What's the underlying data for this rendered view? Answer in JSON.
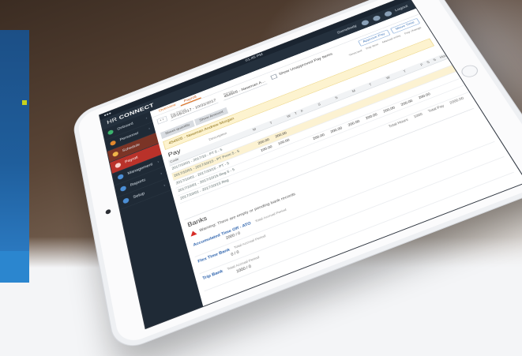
{
  "device": {
    "time": "01:45 PM"
  },
  "app": {
    "brand_light": "HR",
    "brand_bold": "CONNECT",
    "top_right": [
      "Somebody",
      "Logout"
    ]
  },
  "sidebar": {
    "items": [
      {
        "label": "Onboard"
      },
      {
        "label": "Personnel"
      },
      {
        "label": "Schedule"
      },
      {
        "label": "Payroll"
      },
      {
        "label": "Management"
      },
      {
        "label": "Reports"
      },
      {
        "label": "Setup"
      }
    ]
  },
  "tabs": [
    "Overview",
    "Payroll"
  ],
  "filters": {
    "pay_period_label": "Pay Period",
    "pay_period": "10/16/2017 - 10/31/2017",
    "person_label": "Person",
    "person_value": "454505 - Newman A...",
    "checkbox_label": "Show Unapproved Pay Items",
    "buttons": [
      "Approve Pay",
      "Move Time"
    ]
  },
  "legend": [
    "Timecard",
    "Pay item",
    "Manual entry",
    "Pay change"
  ],
  "subtabs": [
    "Sheet quantity",
    "Show Amount"
  ],
  "employee_banner": "454505 - Newman Andrew Morgan",
  "pay": {
    "title": "Pay",
    "header_note": "Description",
    "columns": [
      "Code",
      "M",
      "T",
      "W",
      "T",
      "F",
      "S",
      "S",
      "M",
      "T",
      "W",
      "T",
      "F",
      "S",
      "S",
      "Hours",
      "Total"
    ],
    "rows": [
      {
        "code": "20015",
        "desc": "2017/10/01 - 2017/10 - PT 5 - 5",
        "cells": [
          "",
          "",
          "",
          "",
          "",
          "",
          "",
          "",
          "",
          "",
          "",
          "",
          "",
          "",
          "",
          "100.00",
          "1,000.00"
        ],
        "highlight": false
      },
      {
        "code": "20016",
        "desc": "2017/10/01 - 2017/10/15 - PT Prem 5 - 5",
        "cells": [
          "200.00",
          "200.00",
          "",
          "",
          "",
          "",
          "",
          "",
          "",
          "",
          "",
          "",
          "",
          "",
          "",
          "100.00",
          "100.00"
        ],
        "highlight": true
      },
      {
        "code": "20017",
        "desc": "2017/10/01 - 2017/10/15 - PT - 5",
        "cells": [
          "100.00",
          "100.00",
          "",
          "",
          "",
          "",
          "",
          "",
          "",
          "",
          "",
          "",
          "",
          "",
          "",
          "",
          "100.00"
        ],
        "highlight": false
      },
      {
        "code": "20018",
        "desc": "2017/10/01 - 2017/10/15 Reg 5 - 5",
        "cells": [
          "",
          "",
          "",
          "",
          "200.00",
          "200.00",
          "200.00",
          "200.00",
          "200.00",
          "200.00",
          "200.00",
          "",
          "",
          "",
          "",
          "200.00",
          "Manual"
        ],
        "highlight": false
      },
      {
        "code": "20019",
        "desc": "2017/10/01 - 2017/10/15 Reg",
        "cells": [
          "",
          "",
          "",
          "",
          "",
          "",
          "",
          "",
          "",
          "",
          "",
          "",
          "",
          "",
          "",
          "",
          ""
        ],
        "highlight": false
      }
    ],
    "totals": [
      "Total Hours",
      "1000",
      "Total Pay",
      "2000.00"
    ]
  },
  "banks": {
    "title": "Banks",
    "warning": "Warning: There are empty or pending bank records",
    "items": [
      {
        "name": "Accumulated Time Off - ATO",
        "sub": "Total Accrual Period",
        "value": "2000 / 0"
      },
      {
        "name": "Flex Time Bank",
        "sub": "Total Accrual Period",
        "value": "0 / 0"
      },
      {
        "name": "Trip Bank",
        "sub": "Total Accrual Period",
        "value": "1000 / 0"
      }
    ]
  }
}
